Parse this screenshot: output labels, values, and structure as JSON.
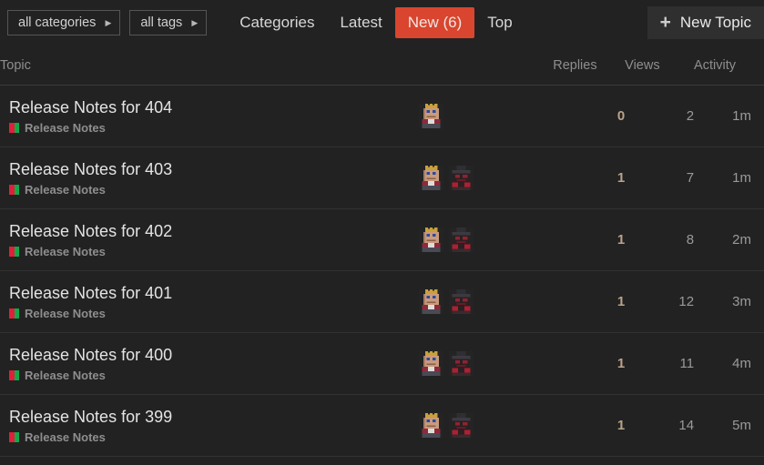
{
  "nav": {
    "filters": [
      {
        "label": "all categories",
        "icon": "chevron-right-icon"
      },
      {
        "label": "all tags",
        "icon": "chevron-right-icon"
      }
    ],
    "tabs": [
      {
        "label": "Categories",
        "active": false
      },
      {
        "label": "Latest",
        "active": false
      },
      {
        "label": "New (6)",
        "active": true
      },
      {
        "label": "Top",
        "active": false
      }
    ],
    "new_topic": {
      "label": "New Topic",
      "icon": "plus-icon"
    }
  },
  "table": {
    "headers": {
      "topic": "Topic",
      "replies": "Replies",
      "views": "Views",
      "activity": "Activity"
    },
    "rows": [
      {
        "title": "Release Notes for 404",
        "category": "Release Notes",
        "avatars": [
          "crown-avatar"
        ],
        "replies": "0",
        "views": "2",
        "activity": "1m"
      },
      {
        "title": "Release Notes for 403",
        "category": "Release Notes",
        "avatars": [
          "crown-avatar",
          "hat-avatar"
        ],
        "replies": "1",
        "views": "7",
        "activity": "1m"
      },
      {
        "title": "Release Notes for 402",
        "category": "Release Notes",
        "avatars": [
          "crown-avatar",
          "hat-avatar"
        ],
        "replies": "1",
        "views": "8",
        "activity": "2m"
      },
      {
        "title": "Release Notes for 401",
        "category": "Release Notes",
        "avatars": [
          "crown-avatar",
          "hat-avatar"
        ],
        "replies": "1",
        "views": "12",
        "activity": "3m"
      },
      {
        "title": "Release Notes for 400",
        "category": "Release Notes",
        "avatars": [
          "crown-avatar",
          "hat-avatar"
        ],
        "replies": "1",
        "views": "11",
        "activity": "4m"
      },
      {
        "title": "Release Notes for 399",
        "category": "Release Notes",
        "avatars": [
          "crown-avatar",
          "hat-avatar"
        ],
        "replies": "1",
        "views": "14",
        "activity": "5m"
      }
    ]
  },
  "colors": {
    "page_bg": "#222222",
    "active_tab_bg": "#d9452e",
    "category_left": "#e0203a",
    "category_right": "#12a84a",
    "replies_accent": "#b9a389"
  }
}
